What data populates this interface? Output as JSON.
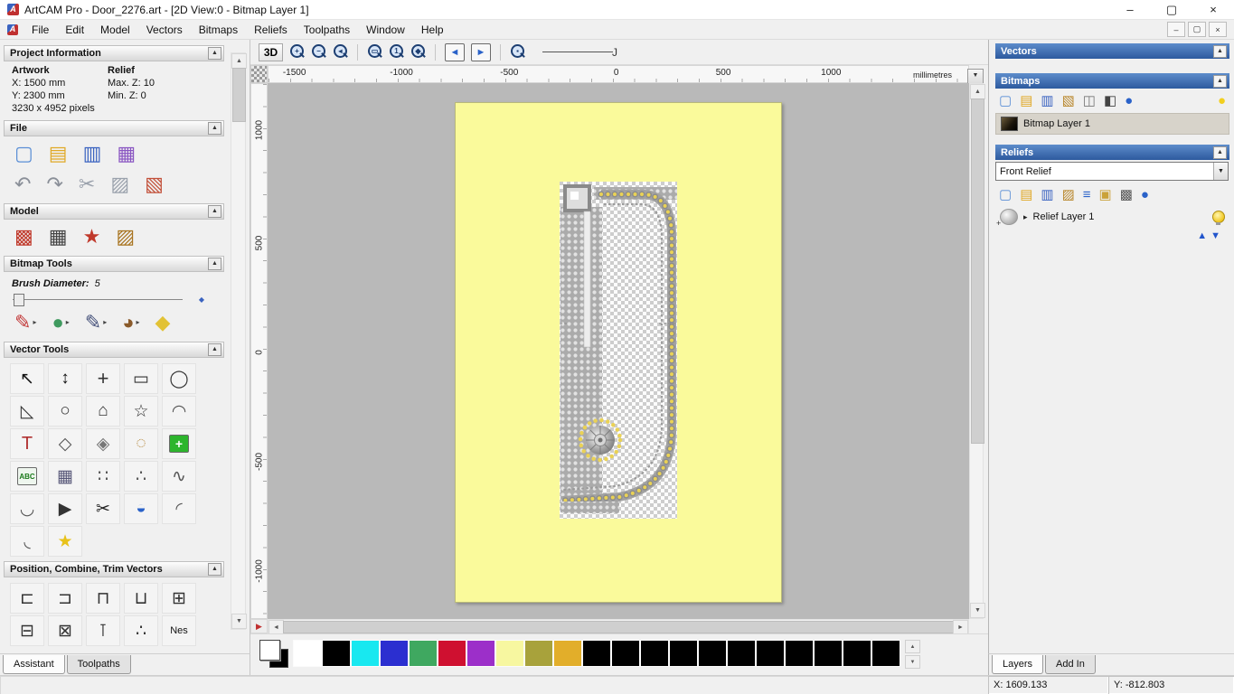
{
  "window": {
    "logo_glyph": "A",
    "title": "ArtCAM Pro - Door_2276.art - [2D View:0 - Bitmap Layer 1]",
    "controls": {
      "minimize": "–",
      "maximize": "▢",
      "close": "×"
    },
    "status": {
      "x": "X: 1609.133",
      "y": "Y: -812.803"
    }
  },
  "ui": {
    "collapse": "▲",
    "dropdown": "▼",
    "expander": "▸",
    "up": "▲",
    "down": "▼",
    "left": "◄",
    "right": "►",
    "overview": "▶",
    "slider_diamond": "◆",
    "spline": "Ј"
  },
  "menubar": {
    "items": [
      "File",
      "Edit",
      "Model",
      "Vectors",
      "Bitmaps",
      "Reliefs",
      "Toolpaths",
      "Window",
      "Help"
    ],
    "mdi": {
      "minimize": "–",
      "restore": "▢",
      "close": "×"
    }
  },
  "assistant": {
    "project_information": {
      "title": "Project Information",
      "artwork_heading": "Artwork",
      "relief_heading": "Relief",
      "artwork_x": "X: 1500 mm",
      "artwork_y": "Y: 2300 mm",
      "relief_max_z": "Max. Z: 10",
      "relief_min_z": "Min. Z: 0",
      "pixels": "3230 x 4952 pixels"
    },
    "file_section": {
      "title": "File",
      "icons_row1": [
        {
          "n": "new-model-icon",
          "g": "▢",
          "c": "#5b8fd6"
        },
        {
          "n": "open-model-icon",
          "g": "▤",
          "c": "#e0a928"
        },
        {
          "n": "save-model-icon",
          "g": "▥",
          "c": "#3a63c0"
        },
        {
          "n": "import-model-icon",
          "g": "▦",
          "c": "#8a56c2"
        }
      ],
      "icons_row2": [
        {
          "n": "undo-icon",
          "g": "↶",
          "c": "#8a8f98"
        },
        {
          "n": "redo-icon",
          "g": "↷",
          "c": "#8a8f98"
        },
        {
          "n": "cut-icon",
          "g": "✂",
          "c": "#9aa1ac"
        },
        {
          "n": "copy-icon",
          "g": "▨",
          "c": "#9aa1ac"
        },
        {
          "n": "paste-icon",
          "g": "▧",
          "c": "#c25039"
        }
      ]
    },
    "model_section": {
      "title": "Model",
      "icons": [
        {
          "n": "set-model-size-icon",
          "g": "▩",
          "c": "#c0392b"
        },
        {
          "n": "model-preview-icon",
          "g": "▦",
          "c": "#444444"
        },
        {
          "n": "model-lighting-icon",
          "g": "★",
          "c": "#c0392b"
        },
        {
          "n": "model-texture-icon",
          "g": "▨",
          "c": "#a87420"
        }
      ]
    },
    "bitmap_tools": {
      "title": "Bitmap Tools",
      "brush_diameter_label": "Brush Diameter:",
      "brush_diameter_value": "5",
      "icons": [
        {
          "n": "paint-tool-icon",
          "g": "✎",
          "c": "#c23939",
          "arrow": true
        },
        {
          "n": "paint-selective-icon",
          "g": "●",
          "c": "#3f9a5f",
          "arrow": true
        },
        {
          "n": "draw-tool-icon",
          "g": "✎",
          "c": "#44507a",
          "arrow": true
        },
        {
          "n": "colour-palette-icon",
          "g": "◕",
          "c": "#8a5a2a",
          "arrow": true
        },
        {
          "n": "flood-fill-icon",
          "g": "◆",
          "c": "#e2c235"
        }
      ]
    },
    "vector_tools": {
      "title": "Vector Tools",
      "icons": [
        {
          "n": "select-vectors-icon",
          "g": "↖",
          "c": "#111111"
        },
        {
          "n": "node-editing-icon",
          "g": "↕",
          "c": "#111111"
        },
        {
          "n": "transform-vectors-icon",
          "g": "+",
          "c": "#333333",
          "fs": 22
        },
        {
          "n": "rectangle-tool-icon",
          "g": "▭",
          "c": "#333333"
        },
        {
          "n": "circle-tool-icon",
          "g": "◯",
          "c": "#333333"
        },
        {
          "n": "polyline-tool-icon",
          "g": "◺",
          "c": "#333333"
        },
        {
          "n": "ellipse-tool-icon",
          "g": "○",
          "c": "#333333"
        },
        {
          "n": "polygon-tool-icon",
          "g": "⌂",
          "c": "#333333"
        },
        {
          "n": "star-tool-icon",
          "g": "☆",
          "c": "#333333"
        },
        {
          "n": "arc-tool-icon",
          "g": "◠",
          "c": "#555555"
        },
        {
          "n": "text-tool-icon",
          "g": "T",
          "c": "#b03030",
          "fs": 20
        },
        {
          "n": "measure-tool-icon",
          "g": "◇",
          "c": "#555555"
        },
        {
          "n": "offset-vectors-icon",
          "g": "◈",
          "c": "#777777"
        },
        {
          "n": "text-on-curve-icon",
          "g": "◌",
          "c": "#b08030"
        },
        {
          "n": "block-paste-icon",
          "g": "+",
          "bg": "#2db52d",
          "c": "#ffffff",
          "fs": 14
        },
        {
          "n": "wrap-text-icon",
          "g": "ABC",
          "bg": "#eef6ee",
          "c": "#1a7a1a",
          "fs": 8
        },
        {
          "n": "grid-tool-icon",
          "g": "▦",
          "c": "#555577"
        },
        {
          "n": "block-copy-icon",
          "g": "∷",
          "c": "#555555"
        },
        {
          "n": "paste-along-curve-icon",
          "g": "∴",
          "c": "#555555"
        },
        {
          "n": "fit-curve-icon",
          "g": "∿",
          "c": "#555555"
        },
        {
          "n": "arc-fit-icon",
          "g": "◡",
          "c": "#555555"
        },
        {
          "n": "join-vectors-icon",
          "g": "▶",
          "c": "#333333"
        },
        {
          "n": "trim-vectors-icon",
          "g": "✂",
          "c": "#222222"
        },
        {
          "n": "envelope-tool-icon",
          "g": "◒",
          "c": "#2a62c9"
        },
        {
          "n": "fillet-tool-icon",
          "g": "◜",
          "c": "#555555"
        },
        {
          "n": "fillet-arc-icon",
          "g": "◟",
          "c": "#555555"
        },
        {
          "n": "vector-doctor-icon",
          "g": "★",
          "c": "#e8c21a"
        }
      ]
    },
    "position_section": {
      "title": "Position, Combine, Trim Vectors",
      "icons": [
        {
          "n": "align-left-icon",
          "g": "⊏",
          "c": "#333333"
        },
        {
          "n": "align-right-icon",
          "g": "⊐",
          "c": "#333333"
        },
        {
          "n": "align-top-icon",
          "g": "⊓",
          "c": "#333333"
        },
        {
          "n": "align-bottom-icon",
          "g": "⊔",
          "c": "#333333"
        },
        {
          "n": "align-center-icon",
          "g": "⊞",
          "c": "#333333"
        },
        {
          "n": "combine-weld-icon",
          "g": "⊟",
          "c": "#333333"
        },
        {
          "n": "combine-subtract-icon",
          "g": "⊠",
          "c": "#333333"
        },
        {
          "n": "slice-vectors-icon",
          "g": "⊺",
          "c": "#333333"
        },
        {
          "n": "scatter-copies-icon",
          "g": "∴",
          "c": "#333333"
        },
        {
          "n": "nesting-icon",
          "g": "Nes",
          "fs": 11,
          "c": "#111111"
        }
      ]
    },
    "tabs": [
      {
        "label": "Assistant",
        "active": true
      },
      {
        "label": "Toolpaths",
        "active": false
      }
    ]
  },
  "viewport": {
    "toolbar": {
      "view_label": "3D",
      "spline_glyph": "Ј",
      "icons": [
        {
          "t": "mag",
          "n": "zoom-in-icon",
          "g": "+"
        },
        {
          "t": "mag",
          "n": "zoom-out-icon",
          "g": "−"
        },
        {
          "t": "mag",
          "n": "zoom-previous-icon",
          "g": "◂"
        },
        {
          "t": "sep"
        },
        {
          "t": "mag",
          "n": "zoom-box-icon",
          "g": "▭"
        },
        {
          "t": "mag",
          "n": "zoom-1to1-icon",
          "g": "1"
        },
        {
          "t": "mag",
          "n": "zoom-fit-icon",
          "g": "◆"
        },
        {
          "t": "sep"
        },
        {
          "n": "pan-left-icon",
          "g": "◄",
          "c": "#2a62c9",
          "bg": "#f8f8f8"
        },
        {
          "n": "pan-right-icon",
          "g": "►",
          "c": "#2a62c9",
          "bg": "#f8f8f8"
        },
        {
          "t": "sep"
        },
        {
          "t": "mag",
          "n": "zoom-objects-icon",
          "g": "▪"
        }
      ]
    },
    "ruler_units": "millimetres",
    "h_ticks": [
      {
        "label": "-1500",
        "pos": 3.7
      },
      {
        "label": "-1000",
        "pos": 19.0
      },
      {
        "label": "-500",
        "pos": 34.4
      },
      {
        "label": "0",
        "pos": 49.7
      },
      {
        "label": "500",
        "pos": 65.0
      },
      {
        "label": "1000",
        "pos": 80.4
      }
    ],
    "v_ticks": [
      {
        "label": "1000",
        "pos": 8.6
      },
      {
        "label": "500",
        "pos": 29.7
      },
      {
        "label": "0",
        "pos": 50.2
      },
      {
        "label": "-500",
        "pos": 70.8
      },
      {
        "label": "-1000",
        "pos": 91.2
      }
    ],
    "workspace_color": "#b9b9b9",
    "sheet_color": "#fafa9b"
  },
  "palette": {
    "foreground": "#ffffff",
    "background": "#000000",
    "swatches": [
      "#ffffff",
      "#000000",
      "#18e8f0",
      "#2b2fd0",
      "#3fa860",
      "#cf1030",
      "#9c2fc9",
      "#f7f7a0",
      "#a8a23b",
      "#e2ae2a",
      "#000000",
      "#000000",
      "#000000",
      "#000000",
      "#000000",
      "#000000",
      "#000000",
      "#000000",
      "#000000",
      "#000000",
      "#000000"
    ]
  },
  "layers_panel": {
    "vectors_title": "Vectors",
    "bitmaps_title": "Bitmaps",
    "bitmaps_icons": [
      {
        "n": "new-bitmap-layer-icon",
        "g": "▢",
        "c": "#5b8fd6"
      },
      {
        "n": "open-bitmap-layer-icon",
        "g": "▤",
        "c": "#e0a928"
      },
      {
        "n": "save-bitmap-layer-icon",
        "g": "▥",
        "c": "#3a63c0"
      },
      {
        "n": "paint-layer-icon",
        "g": "▧",
        "c": "#b8862a"
      },
      {
        "n": "merge-layers-icon",
        "g": "◫",
        "c": "#777777"
      },
      {
        "n": "greyscale-layer-icon",
        "g": "◧",
        "c": "#444444"
      },
      {
        "n": "sphere-preview-icon",
        "g": "●",
        "c": "#2a62c9"
      },
      {
        "t": "spacer"
      },
      {
        "n": "bitmap-visibility-bulb-icon",
        "g": "●",
        "c": "#f2cf1f"
      }
    ],
    "bitmap_layer_name": "Bitmap Layer 1",
    "reliefs_title": "Reliefs",
    "relief_selector": "Front Relief",
    "reliefs_icons": [
      {
        "n": "new-relief-layer-icon",
        "g": "▢",
        "c": "#5b8fd6"
      },
      {
        "n": "open-relief-layer-icon",
        "g": "▤",
        "c": "#e0a928"
      },
      {
        "n": "save-relief-layer-icon",
        "g": "▥",
        "c": "#3a63c0"
      },
      {
        "n": "duplicate-relief-icon",
        "g": "▨",
        "c": "#b8862a"
      },
      {
        "n": "relief-stack-icon",
        "g": "≡",
        "c": "#2a62c9"
      },
      {
        "n": "new-from-bitmap-icon",
        "g": "▣",
        "c": "#caa23a"
      },
      {
        "n": "relief-transparency-icon",
        "g": "▩",
        "c": "#555555"
      },
      {
        "n": "relief-sphere-preview-icon",
        "g": "●",
        "c": "#2a62c9"
      }
    ],
    "relief_layer_name": "Relief Layer 1",
    "tabs": [
      {
        "label": "Layers",
        "active": true
      },
      {
        "label": "Add In",
        "active": false
      }
    ]
  }
}
